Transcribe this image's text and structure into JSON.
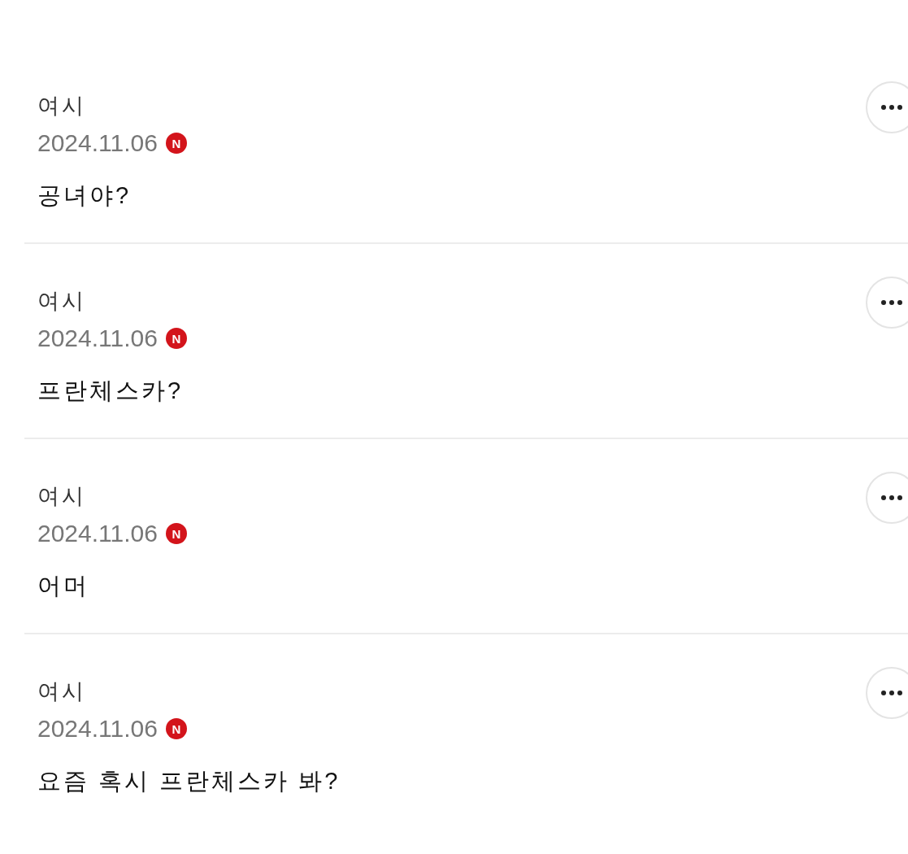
{
  "comments": [
    {
      "author": "여시",
      "date": "2024.11.06",
      "badge": "N",
      "content": "공녀야?"
    },
    {
      "author": "여시",
      "date": "2024.11.06",
      "badge": "N",
      "content": "프란체스카?"
    },
    {
      "author": "여시",
      "date": "2024.11.06",
      "badge": "N",
      "content": "어머"
    },
    {
      "author": "여시",
      "date": "2024.11.06",
      "badge": "N",
      "content": "요즘 혹시 프란체스카 봐?"
    }
  ]
}
